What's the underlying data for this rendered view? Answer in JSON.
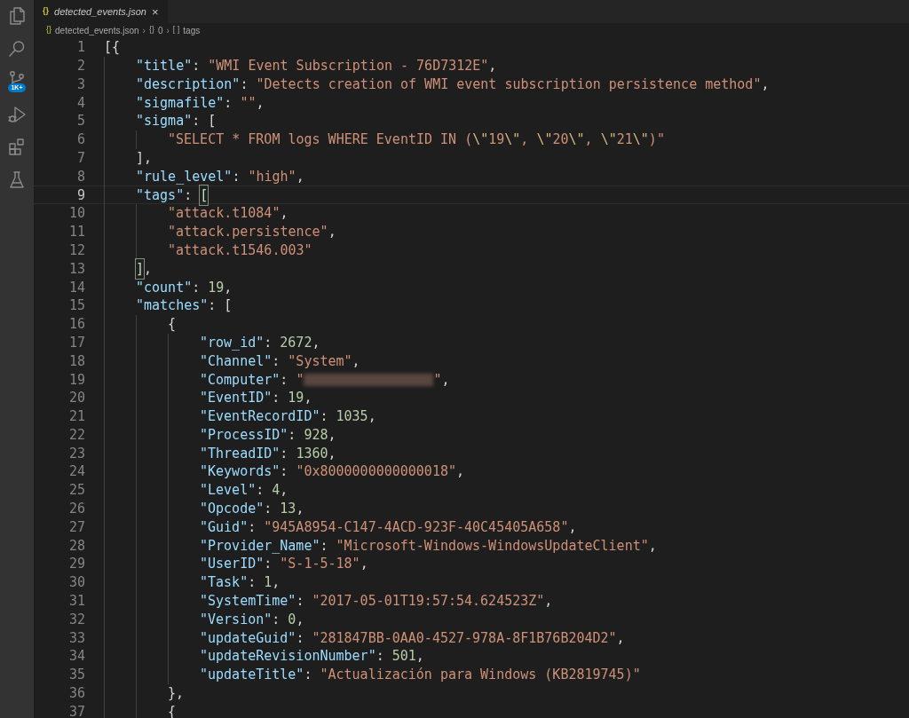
{
  "activity_bar": {
    "items": [
      {
        "kind": "files"
      },
      {
        "kind": "search"
      },
      {
        "kind": "source-control",
        "badge": "1K+"
      },
      {
        "kind": "run"
      },
      {
        "kind": "extensions"
      },
      {
        "kind": "testing"
      }
    ]
  },
  "tabs": [
    {
      "icon_glyph": "{}",
      "label": "detected_events.json",
      "selected": true,
      "close": "×"
    }
  ],
  "breadcrumb": [
    {
      "icon_glyph": "{}",
      "label": "detected_events.json"
    },
    {
      "icon_glyph": "{}",
      "label": "0"
    },
    {
      "icon_glyph": "[ ]",
      "label": "tags"
    }
  ],
  "breadcrumb_separator": "›",
  "editor": {
    "lines": [
      {
        "number": "1",
        "tokens": [
          {
            "kind": "punct",
            "text": "[{"
          }
        ],
        "children": [
          {
            "number": "2",
            "tokens": [
              {
                "kind": "key",
                "text": "\"title\""
              },
              {
                "kind": "punct",
                "text": ": "
              },
              {
                "kind": "string",
                "text": "\"WMI Event Subscription - 76D7312E\""
              },
              {
                "kind": "punct",
                "text": ","
              }
            ]
          },
          {
            "number": "3",
            "tokens": [
              {
                "kind": "key",
                "text": "\"description\""
              },
              {
                "kind": "punct",
                "text": ": "
              },
              {
                "kind": "string",
                "text": "\"Detects creation of WMI event subscription persistence method\""
              },
              {
                "kind": "punct",
                "text": ","
              }
            ]
          },
          {
            "number": "4",
            "tokens": [
              {
                "kind": "key",
                "text": "\"sigmafile\""
              },
              {
                "kind": "punct",
                "text": ": "
              },
              {
                "kind": "string",
                "text": "\"\""
              },
              {
                "kind": "punct",
                "text": ","
              }
            ]
          },
          {
            "number": "5",
            "tokens": [
              {
                "kind": "key",
                "text": "\"sigma\""
              },
              {
                "kind": "punct",
                "text": ": ["
              }
            ],
            "children": [
              {
                "number": "6",
                "tokens": [
                  {
                    "kind": "string",
                    "text": "\"SELECT * FROM logs WHERE EventID IN ("
                  },
                  {
                    "kind": "escape",
                    "text": "\\\""
                  },
                  {
                    "kind": "string",
                    "text": "19"
                  },
                  {
                    "kind": "escape",
                    "text": "\\\""
                  },
                  {
                    "kind": "string",
                    "text": ", "
                  },
                  {
                    "kind": "escape",
                    "text": "\\\""
                  },
                  {
                    "kind": "string",
                    "text": "20"
                  },
                  {
                    "kind": "escape",
                    "text": "\\\""
                  },
                  {
                    "kind": "string",
                    "text": ", "
                  },
                  {
                    "kind": "escape",
                    "text": "\\\""
                  },
                  {
                    "kind": "string",
                    "text": "21"
                  },
                  {
                    "kind": "escape",
                    "text": "\\\""
                  },
                  {
                    "kind": "string",
                    "text": ")\""
                  }
                ]
              }
            ]
          },
          {
            "number": "7",
            "tokens": [
              {
                "kind": "punct",
                "text": "],"
              }
            ]
          },
          {
            "number": "8",
            "tokens": [
              {
                "kind": "key",
                "text": "\"rule_level\""
              },
              {
                "kind": "punct",
                "text": ": "
              },
              {
                "kind": "string",
                "text": "\"high\""
              },
              {
                "kind": "punct",
                "text": ","
              }
            ]
          },
          {
            "number": "9",
            "current": true,
            "tokens": [
              {
                "kind": "key",
                "text": "\"tags\""
              },
              {
                "kind": "punct",
                "text": ": "
              },
              {
                "kind": "bracket-match",
                "text": "["
              }
            ],
            "children": [
              {
                "number": "10",
                "tokens": [
                  {
                    "kind": "string",
                    "text": "\"attack.t1084\""
                  },
                  {
                    "kind": "punct",
                    "text": ","
                  }
                ]
              },
              {
                "number": "11",
                "tokens": [
                  {
                    "kind": "string",
                    "text": "\"attack.persistence\""
                  },
                  {
                    "kind": "punct",
                    "text": ","
                  }
                ]
              },
              {
                "number": "12",
                "tokens": [
                  {
                    "kind": "string",
                    "text": "\"attack.t1546.003\""
                  }
                ]
              }
            ]
          },
          {
            "number": "13",
            "tokens": [
              {
                "kind": "bracket-match",
                "text": "]"
              },
              {
                "kind": "punct",
                "text": ","
              }
            ]
          },
          {
            "number": "14",
            "tokens": [
              {
                "kind": "key",
                "text": "\"count\""
              },
              {
                "kind": "punct",
                "text": ": "
              },
              {
                "kind": "number",
                "text": "19"
              },
              {
                "kind": "punct",
                "text": ","
              }
            ]
          },
          {
            "number": "15",
            "tokens": [
              {
                "kind": "key",
                "text": "\"matches\""
              },
              {
                "kind": "punct",
                "text": ": ["
              }
            ],
            "children": [
              {
                "number": "16",
                "tokens": [
                  {
                    "kind": "punct",
                    "text": "{"
                  }
                ],
                "children": [
                  {
                    "number": "17",
                    "tokens": [
                      {
                        "kind": "key",
                        "text": "\"row_id\""
                      },
                      {
                        "kind": "punct",
                        "text": ": "
                      },
                      {
                        "kind": "number",
                        "text": "2672"
                      },
                      {
                        "kind": "punct",
                        "text": ","
                      }
                    ]
                  },
                  {
                    "number": "18",
                    "tokens": [
                      {
                        "kind": "key",
                        "text": "\"Channel\""
                      },
                      {
                        "kind": "punct",
                        "text": ": "
                      },
                      {
                        "kind": "string",
                        "text": "\"System\""
                      },
                      {
                        "kind": "punct",
                        "text": ","
                      }
                    ]
                  },
                  {
                    "number": "19",
                    "tokens": [
                      {
                        "kind": "key",
                        "text": "\"Computer\""
                      },
                      {
                        "kind": "punct",
                        "text": ": "
                      },
                      {
                        "kind": "string",
                        "text": "\""
                      },
                      {
                        "kind": "redacted"
                      },
                      {
                        "kind": "string",
                        "text": "\""
                      },
                      {
                        "kind": "punct",
                        "text": ","
                      }
                    ]
                  },
                  {
                    "number": "20",
                    "tokens": [
                      {
                        "kind": "key",
                        "text": "\"EventID\""
                      },
                      {
                        "kind": "punct",
                        "text": ": "
                      },
                      {
                        "kind": "number",
                        "text": "19"
                      },
                      {
                        "kind": "punct",
                        "text": ","
                      }
                    ]
                  },
                  {
                    "number": "21",
                    "tokens": [
                      {
                        "kind": "key",
                        "text": "\"EventRecordID\""
                      },
                      {
                        "kind": "punct",
                        "text": ": "
                      },
                      {
                        "kind": "number",
                        "text": "1035"
                      },
                      {
                        "kind": "punct",
                        "text": ","
                      }
                    ]
                  },
                  {
                    "number": "22",
                    "tokens": [
                      {
                        "kind": "key",
                        "text": "\"ProcessID\""
                      },
                      {
                        "kind": "punct",
                        "text": ": "
                      },
                      {
                        "kind": "number",
                        "text": "928"
                      },
                      {
                        "kind": "punct",
                        "text": ","
                      }
                    ]
                  },
                  {
                    "number": "23",
                    "tokens": [
                      {
                        "kind": "key",
                        "text": "\"ThreadID\""
                      },
                      {
                        "kind": "punct",
                        "text": ": "
                      },
                      {
                        "kind": "number",
                        "text": "1360"
                      },
                      {
                        "kind": "punct",
                        "text": ","
                      }
                    ]
                  },
                  {
                    "number": "24",
                    "tokens": [
                      {
                        "kind": "key",
                        "text": "\"Keywords\""
                      },
                      {
                        "kind": "punct",
                        "text": ": "
                      },
                      {
                        "kind": "string",
                        "text": "\"0x8000000000000018\""
                      },
                      {
                        "kind": "punct",
                        "text": ","
                      }
                    ]
                  },
                  {
                    "number": "25",
                    "tokens": [
                      {
                        "kind": "key",
                        "text": "\"Level\""
                      },
                      {
                        "kind": "punct",
                        "text": ": "
                      },
                      {
                        "kind": "number",
                        "text": "4"
                      },
                      {
                        "kind": "punct",
                        "text": ","
                      }
                    ]
                  },
                  {
                    "number": "26",
                    "tokens": [
                      {
                        "kind": "key",
                        "text": "\"Opcode\""
                      },
                      {
                        "kind": "punct",
                        "text": ": "
                      },
                      {
                        "kind": "number",
                        "text": "13"
                      },
                      {
                        "kind": "punct",
                        "text": ","
                      }
                    ]
                  },
                  {
                    "number": "27",
                    "tokens": [
                      {
                        "kind": "key",
                        "text": "\"Guid\""
                      },
                      {
                        "kind": "punct",
                        "text": ": "
                      },
                      {
                        "kind": "string",
                        "text": "\"945A8954-C147-4ACD-923F-40C45405A658\""
                      },
                      {
                        "kind": "punct",
                        "text": ","
                      }
                    ]
                  },
                  {
                    "number": "28",
                    "tokens": [
                      {
                        "kind": "key",
                        "text": "\"Provider_Name\""
                      },
                      {
                        "kind": "punct",
                        "text": ": "
                      },
                      {
                        "kind": "string",
                        "text": "\"Microsoft-Windows-WindowsUpdateClient\""
                      },
                      {
                        "kind": "punct",
                        "text": ","
                      }
                    ]
                  },
                  {
                    "number": "29",
                    "tokens": [
                      {
                        "kind": "key",
                        "text": "\"UserID\""
                      },
                      {
                        "kind": "punct",
                        "text": ": "
                      },
                      {
                        "kind": "string",
                        "text": "\"S-1-5-18\""
                      },
                      {
                        "kind": "punct",
                        "text": ","
                      }
                    ]
                  },
                  {
                    "number": "30",
                    "tokens": [
                      {
                        "kind": "key",
                        "text": "\"Task\""
                      },
                      {
                        "kind": "punct",
                        "text": ": "
                      },
                      {
                        "kind": "number",
                        "text": "1"
                      },
                      {
                        "kind": "punct",
                        "text": ","
                      }
                    ]
                  },
                  {
                    "number": "31",
                    "tokens": [
                      {
                        "kind": "key",
                        "text": "\"SystemTime\""
                      },
                      {
                        "kind": "punct",
                        "text": ": "
                      },
                      {
                        "kind": "string",
                        "text": "\"2017-05-01T19:57:54.624523Z\""
                      },
                      {
                        "kind": "punct",
                        "text": ","
                      }
                    ]
                  },
                  {
                    "number": "32",
                    "tokens": [
                      {
                        "kind": "key",
                        "text": "\"Version\""
                      },
                      {
                        "kind": "punct",
                        "text": ": "
                      },
                      {
                        "kind": "number",
                        "text": "0"
                      },
                      {
                        "kind": "punct",
                        "text": ","
                      }
                    ]
                  },
                  {
                    "number": "33",
                    "tokens": [
                      {
                        "kind": "key",
                        "text": "\"updateGuid\""
                      },
                      {
                        "kind": "punct",
                        "text": ": "
                      },
                      {
                        "kind": "string",
                        "text": "\"281847BB-0AA0-4527-978A-8F1B76B204D2\""
                      },
                      {
                        "kind": "punct",
                        "text": ","
                      }
                    ]
                  },
                  {
                    "number": "34",
                    "tokens": [
                      {
                        "kind": "key",
                        "text": "\"updateRevisionNumber\""
                      },
                      {
                        "kind": "punct",
                        "text": ": "
                      },
                      {
                        "kind": "number",
                        "text": "501"
                      },
                      {
                        "kind": "punct",
                        "text": ","
                      }
                    ]
                  },
                  {
                    "number": "35",
                    "tokens": [
                      {
                        "kind": "key",
                        "text": "\"updateTitle\""
                      },
                      {
                        "kind": "punct",
                        "text": ": "
                      },
                      {
                        "kind": "string",
                        "text": "\"Actualización para Windows (KB2819745)\""
                      }
                    ]
                  }
                ]
              },
              {
                "number": "36",
                "tokens": [
                  {
                    "kind": "punct",
                    "text": "},"
                  }
                ]
              },
              {
                "number": "37",
                "tokens": [
                  {
                    "kind": "punct",
                    "text": "{"
                  }
                ]
              }
            ]
          }
        ]
      }
    ]
  }
}
